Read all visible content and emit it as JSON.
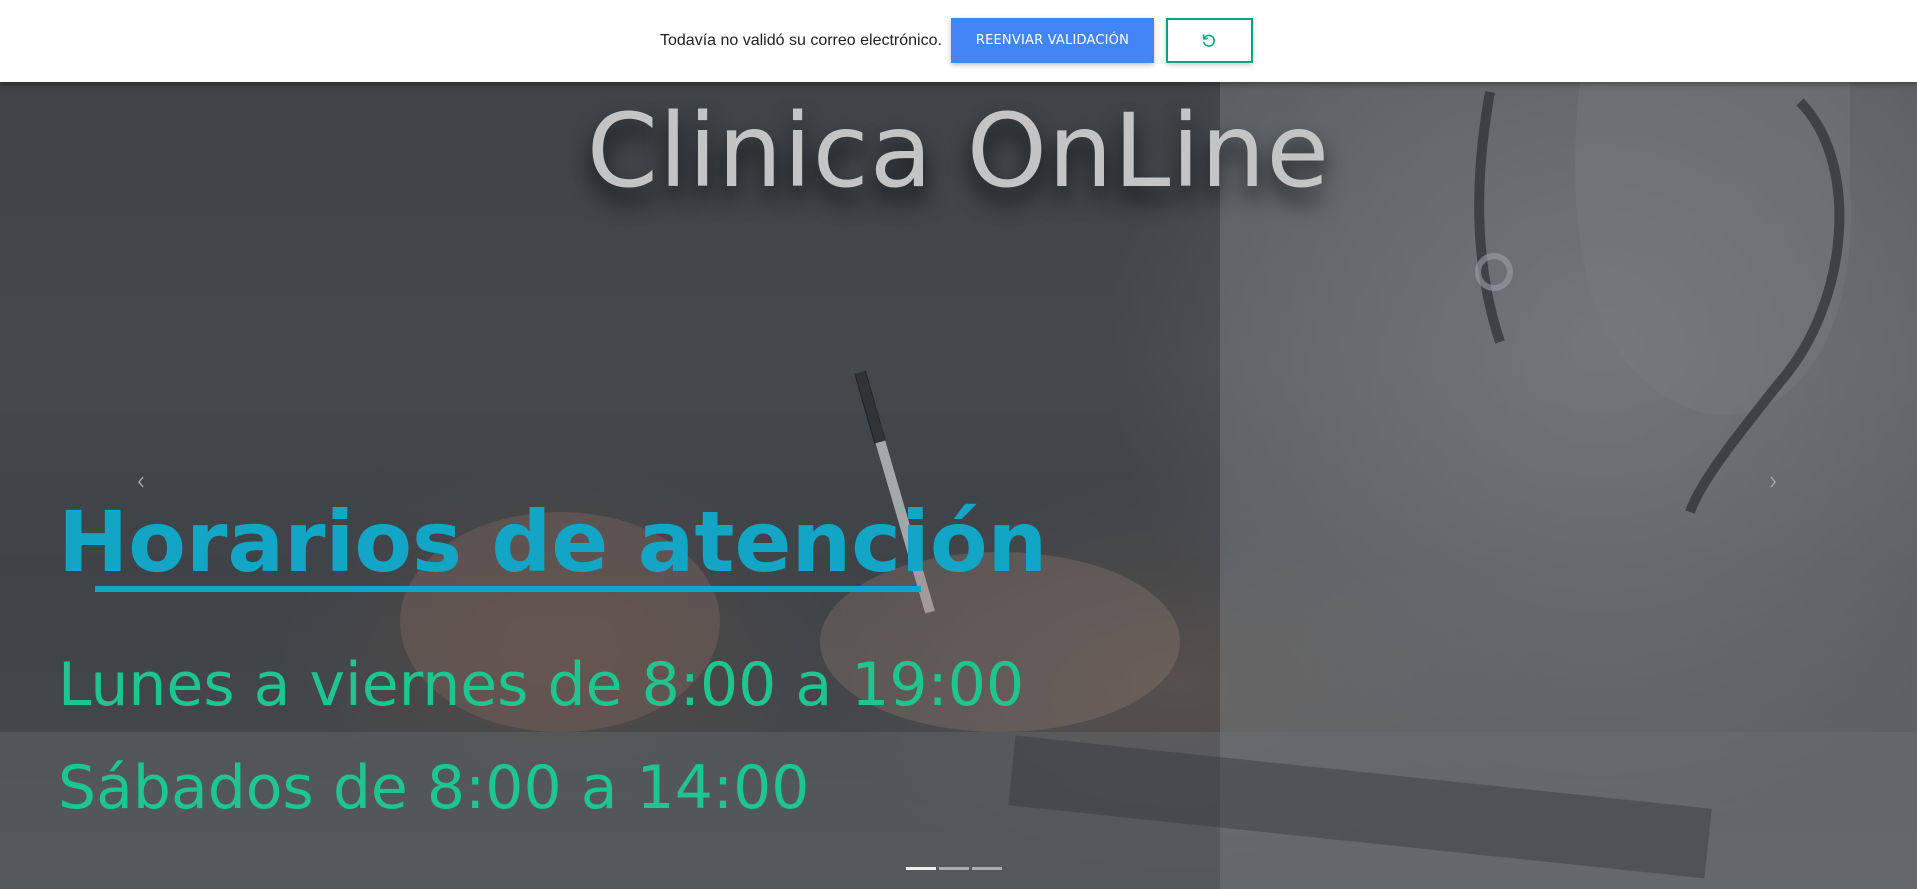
{
  "notice": {
    "message": "Todavía no validó su correo electrónico.",
    "resend_label": "REENVIAR VALIDACIÓN",
    "reload_icon": "reload-icon"
  },
  "hero": {
    "title": "Clinica OnLine",
    "prev_icon": "chevron-left-icon",
    "next_icon": "chevron-right-icon",
    "heading": "Horarios de atención",
    "schedule": [
      "Lunes a viernes de 8:00 a 19:00",
      "Sábados de 8:00 a 14:00"
    ],
    "slides_count": 3,
    "active_slide": 1
  },
  "colors": {
    "resend_button": "#4285f4",
    "reload_border": "#00a683",
    "heading": "#12a5c6",
    "schedule": "#1fc58e",
    "title": "#c4c4c4"
  }
}
